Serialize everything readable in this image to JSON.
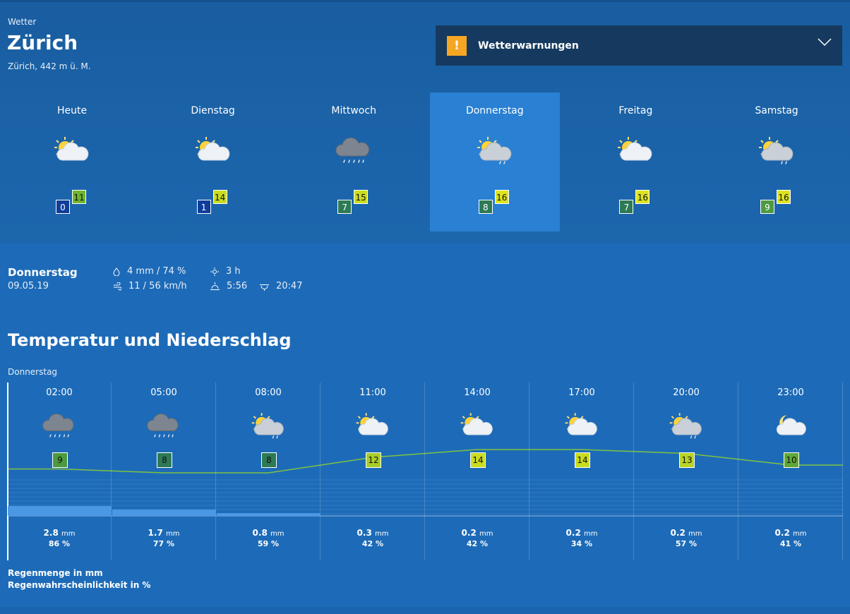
{
  "header": {
    "kicker": "Wetter",
    "city": "Zürich",
    "altitude": "Zürich, 442 m ü. M."
  },
  "warning": {
    "label": "Wetterwarnungen",
    "badge": "!"
  },
  "colors": {
    "selected_day": "#2a80d2",
    "warning_badge": "#f5a623",
    "temp_line": "#7fc241"
  },
  "days": [
    {
      "name": "Heute",
      "icon": "sun-cloud-icon",
      "min": "0",
      "max": "11",
      "min_color": "#0f3d99",
      "max_color": "#6fb52e",
      "selected": false
    },
    {
      "name": "Dienstag",
      "icon": "sun-cloud-icon",
      "min": "1",
      "max": "14",
      "min_color": "#0f3d99",
      "max_color": "#c9dc1f",
      "selected": false
    },
    {
      "name": "Mittwoch",
      "icon": "rain-cloud-icon",
      "min": "7",
      "max": "15",
      "min_color": "#2d7a55",
      "max_color": "#c9dc1f",
      "selected": false
    },
    {
      "name": "Donnerstag",
      "icon": "sun-rain-cloud-icon",
      "min": "8",
      "max": "16",
      "min_color": "#2d7a55",
      "max_color": "#dde321",
      "selected": true
    },
    {
      "name": "Freitag",
      "icon": "sun-cloud-icon",
      "min": "7",
      "max": "16",
      "min_color": "#2d7a55",
      "max_color": "#dde321",
      "selected": false
    },
    {
      "name": "Samstag",
      "icon": "sun-rain-cloud-icon",
      "min": "9",
      "max": "16",
      "min_color": "#4d9a3e",
      "max_color": "#dde321",
      "selected": false
    }
  ],
  "detail": {
    "day": "Donnerstag",
    "date": "09.05.19",
    "precip": "4 mm / 74 %",
    "wind": "11 / 56 km/h",
    "sunshine": "3 h",
    "sunrise": "5:56",
    "sunset": "20:47"
  },
  "section": {
    "title": "Temperatur und Niederschlag",
    "subtitle": "Donnerstag"
  },
  "hourly": [
    {
      "time": "02:00",
      "icon": "rain-cloud-icon",
      "temp": "9",
      "temp_color": "#4d9a3e",
      "amount": "2.8",
      "unit": "mm",
      "prob": "86 %",
      "mm": 2.8
    },
    {
      "time": "05:00",
      "icon": "rain-cloud-icon",
      "temp": "8",
      "temp_color": "#2d7a55",
      "amount": "1.7",
      "unit": "mm",
      "prob": "77 %",
      "mm": 1.7
    },
    {
      "time": "08:00",
      "icon": "sun-rain-cloud-icon",
      "temp": "8",
      "temp_color": "#2d7a55",
      "amount": "0.8",
      "unit": "mm",
      "prob": "59 %",
      "mm": 0.8
    },
    {
      "time": "11:00",
      "icon": "sun-cloud-icon",
      "temp": "12",
      "temp_color": "#a9cc2a",
      "amount": "0.3",
      "unit": "mm",
      "prob": "42 %",
      "mm": 0.3
    },
    {
      "time": "14:00",
      "icon": "sun-cloud-icon",
      "temp": "14",
      "temp_color": "#c9dc1f",
      "amount": "0.2",
      "unit": "mm",
      "prob": "42 %",
      "mm": 0.2
    },
    {
      "time": "17:00",
      "icon": "sun-cloud-icon",
      "temp": "14",
      "temp_color": "#c9dc1f",
      "amount": "0.2",
      "unit": "mm",
      "prob": "34 %",
      "mm": 0.2
    },
    {
      "time": "20:00",
      "icon": "sun-rain-cloud-icon",
      "temp": "13",
      "temp_color": "#b9d424",
      "amount": "0.2",
      "unit": "mm",
      "prob": "57 %",
      "mm": 0.2
    },
    {
      "time": "23:00",
      "icon": "moon-cloud-icon",
      "temp": "10",
      "temp_color": "#5fa837",
      "amount": "0.2",
      "unit": "mm",
      "prob": "41 %",
      "mm": 0.2
    }
  ],
  "legend": {
    "rain_amount": "Regenmenge in mm",
    "rain_probability": "Regenwahrscheinlichkeit in %"
  }
}
